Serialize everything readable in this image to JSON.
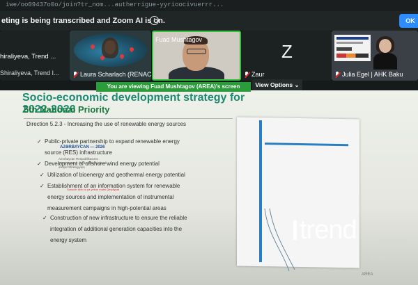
{
  "browser": {
    "url_fragment": "iwe/oo09437o0o/join?tr_nom...autherrigue-yyrioocivuerrr..."
  },
  "banner": {
    "text": "eting is being transcribed and Zoom AI is on.",
    "ok_label": "OK"
  },
  "participants": [
    {
      "name": "hiraliyeva, Trend ...",
      "sub": "Shiraliyeva, Trend I..."
    },
    {
      "name": "Laura Scharlach (RENAC ..."
    },
    {
      "name": "Fuad Mushtagov"
    },
    {
      "name": "Zaur",
      "avatar_letter": "Z"
    },
    {
      "name": "Julia Egel | AHK Baku"
    }
  ],
  "share_bar": {
    "viewing_text": "You are viewing  Fuad Mushtagov (AREA)'s screen",
    "view_options": "View Options"
  },
  "slide": {
    "title": "Socio-economic development strategy for 2022-2026",
    "subtitle": "5th National Priority",
    "direction": "Direction 5.2.3 - Increasing the use of renewable energy sources",
    "bullets": [
      {
        "lines": [
          "Public-private partnership to expand renewable energy",
          "source (RES) infrastructure"
        ]
      },
      {
        "lines": [
          "Development of offshore wind energy potential"
        ]
      },
      {
        "lines": [
          "Utilization of bioenergy and geothermal energy potential"
        ]
      },
      {
        "lines": [
          "Establishment of an information system for renewable",
          "energy sources and implementation of instrumental",
          "measurement campaigns in high-potential areas"
        ]
      },
      {
        "lines": [
          "Construction of new infrastructure to ensure the reliable",
          "integration of additional generation capacities into the",
          "energy system"
        ]
      }
    ]
  },
  "report_cover": {
    "heading": "AZƏRBAYCAN — 2026",
    "body": "Azərbaycan Respublikasının 2022–2026-cı illərdə sosial-iqtisadi inkişaf Strategiyası",
    "note": "Sənədin ilkin və ya yekun mətni Qeydiyyat"
  },
  "watermarks": {
    "brand": "trend",
    "windows_line1": "Windows",
    "windows_line2": "ровать Windo",
    "windows_line3": "метры\".",
    "footer": "AREA"
  },
  "colors": {
    "accent_green": "#2b9c3a",
    "slide_title": "#1a8b73",
    "ok_blue": "#2d8cff"
  }
}
